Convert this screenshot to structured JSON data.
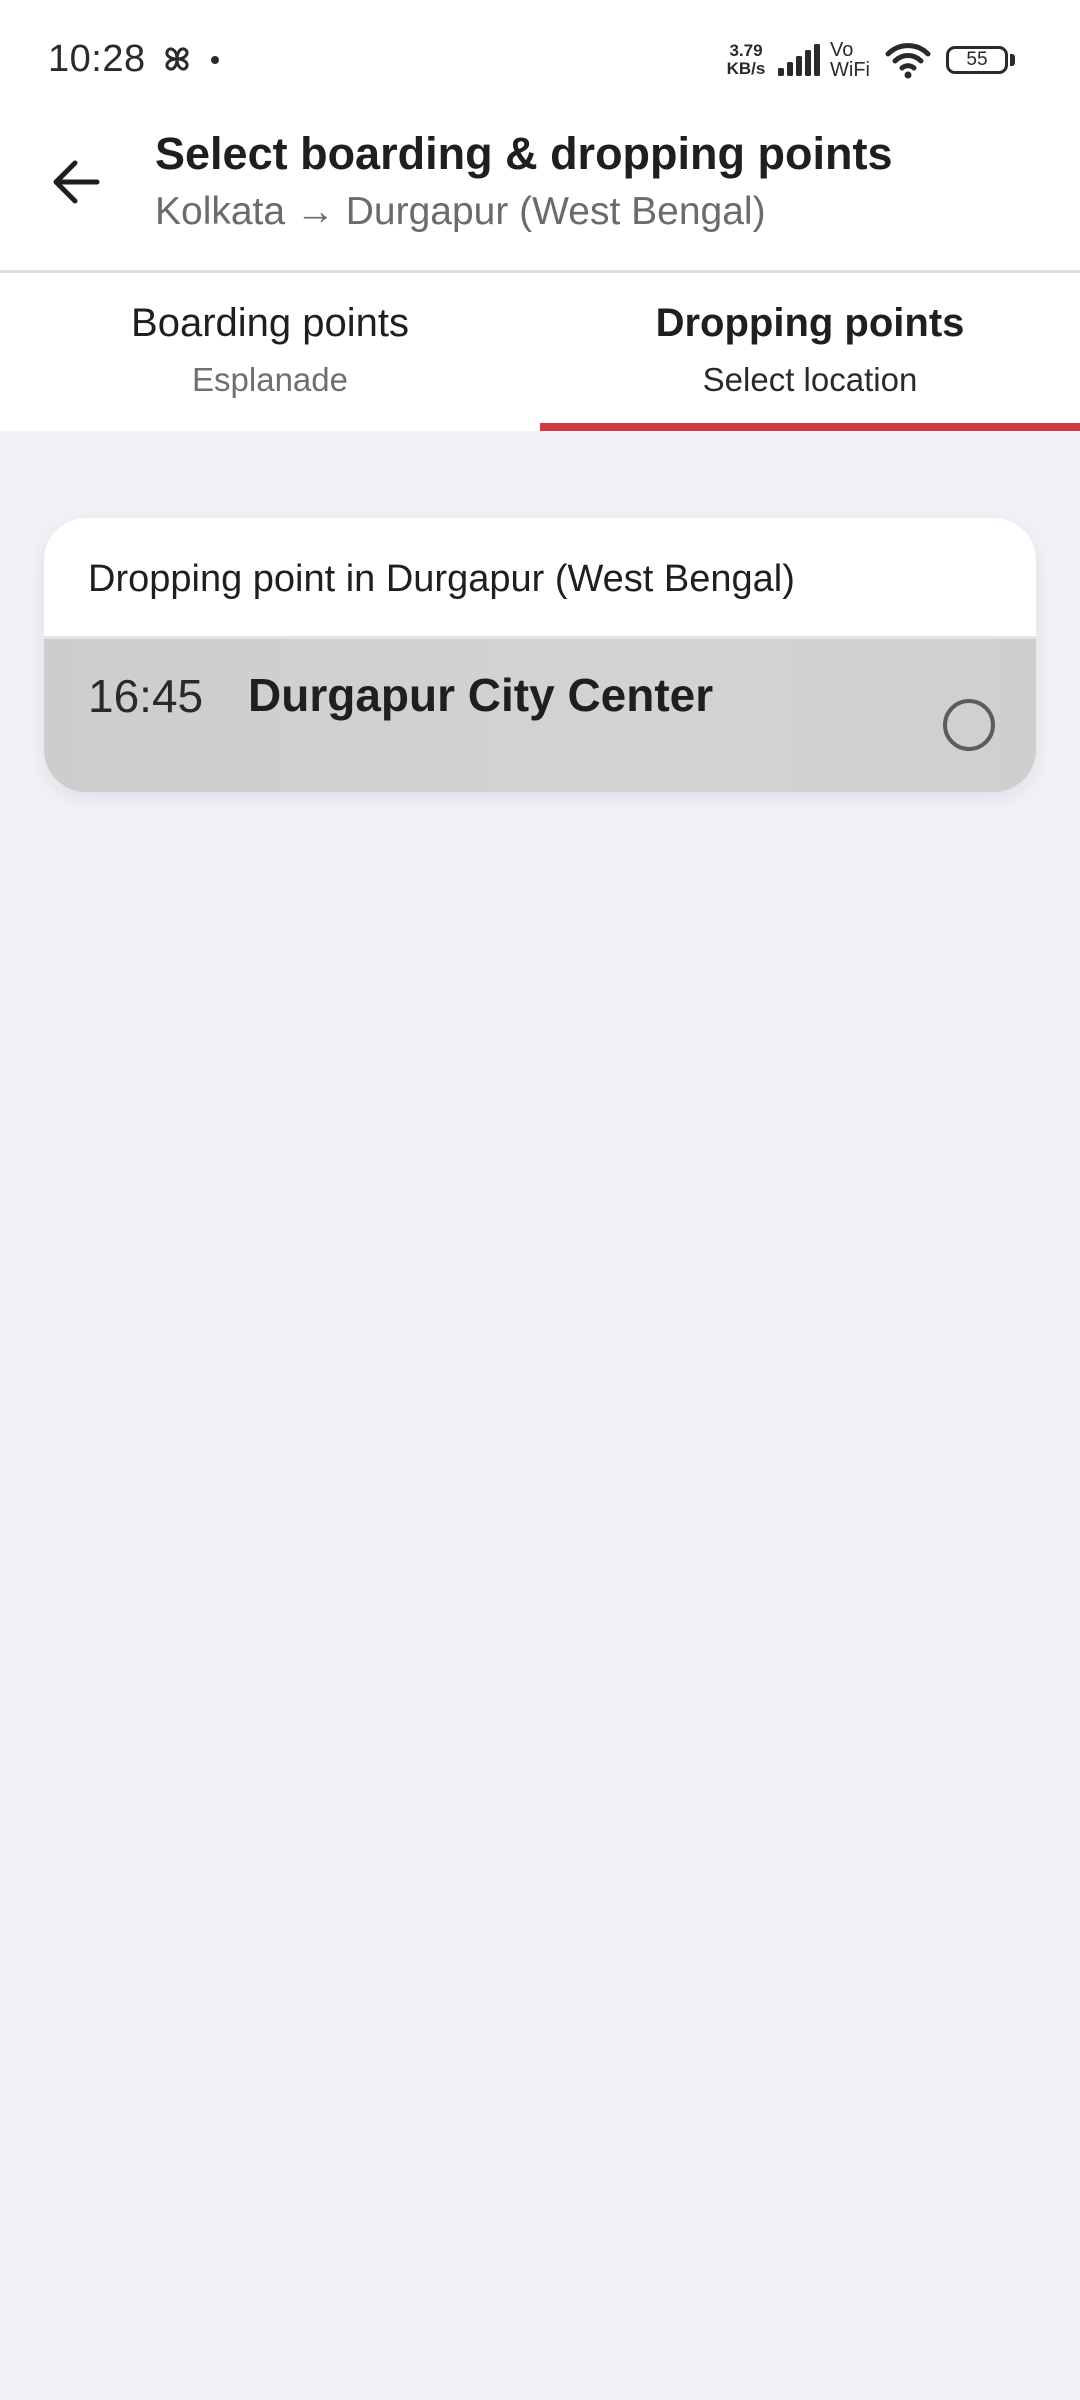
{
  "status_bar": {
    "time": "10:28",
    "net_speed_value": "3.79",
    "net_speed_unit": "KB/s",
    "vowifi_top": "Vo",
    "vowifi_bottom": "WiFi",
    "battery": "55",
    "icons": [
      "pinwheel-icon",
      "signal-icon",
      "wifi-icon",
      "battery-icon"
    ]
  },
  "header": {
    "title": "Select boarding & dropping points",
    "subtitle": "Kolkata → Durgapur (West Bengal)",
    "back_icon": "arrow-left-icon"
  },
  "tabs": [
    {
      "label": "Boarding points",
      "sublabel": "Esplanade",
      "active": false
    },
    {
      "label": "Dropping points",
      "sublabel": "Select location",
      "active": true
    }
  ],
  "dropping_card": {
    "heading": "Dropping point in Durgapur (West Bengal)",
    "points": [
      {
        "time": "16:45",
        "name": "Durgapur City Center",
        "selected": false
      }
    ]
  },
  "colors": {
    "accent": "#d1383f",
    "background": "#f1f1f7",
    "card": "#ffffff",
    "row_highlight": "#d0d0d0"
  }
}
